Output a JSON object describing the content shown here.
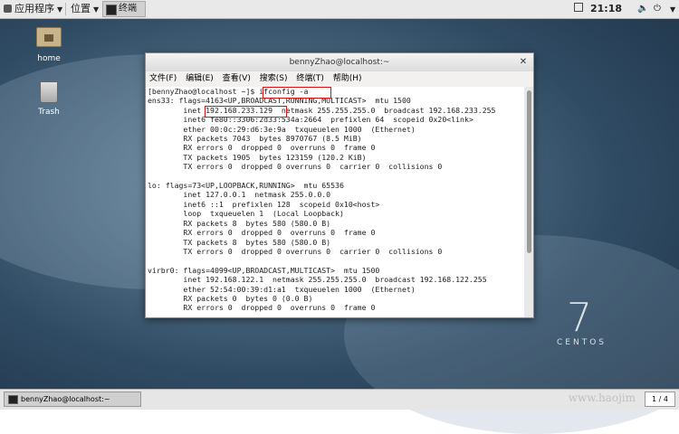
{
  "topbar": {
    "apps_label": "应用程序",
    "places_label": "位置",
    "terminal_label": "终端",
    "clock": "21:18"
  },
  "desktop_icons": {
    "home": "home",
    "trash": "Trash"
  },
  "window": {
    "title": "bennyZhao@localhost:~",
    "menu": [
      "文件(F)",
      "编辑(E)",
      "查看(V)",
      "搜索(S)",
      "终端(T)",
      "帮助(H)"
    ],
    "lines": [
      "[bennyZhao@localhost ~]$ ifconfig -a",
      "ens33: flags=4163<UP,BROADCAST,RUNNING,MULTICAST>  mtu 1500",
      "        inet 192.168.233.129  netmask 255.255.255.0  broadcast 192.168.233.255",
      "        inet6 fe80::3306:2d33:534a:2664  prefixlen 64  scopeid 0x20<link>",
      "        ether 00:0c:29:d6:3e:9a  txqueuelen 1000  (Ethernet)",
      "        RX packets 7043  bytes 8970767 (8.5 MiB)",
      "        RX errors 0  dropped 0  overruns 0  frame 0",
      "        TX packets 1905  bytes 123159 (120.2 KiB)",
      "        TX errors 0  dropped 0 overruns 0  carrier 0  collisions 0",
      "",
      "lo: flags=73<UP,LOOPBACK,RUNNING>  mtu 65536",
      "        inet 127.0.0.1  netmask 255.0.0.0",
      "        inet6 ::1  prefixlen 128  scopeid 0x10<host>",
      "        loop  txqueuelen 1  (Local Loopback)",
      "        RX packets 8  bytes 580 (580.0 B)",
      "        RX errors 0  dropped 0  overruns 0  frame 0",
      "        TX packets 8  bytes 580 (580.0 B)",
      "        TX errors 0  dropped 0 overruns 0  carrier 0  collisions 0",
      "",
      "virbr0: flags=4099<UP,BROADCAST,MULTICAST>  mtu 1500",
      "        inet 192.168.122.1  netmask 255.255.255.0  broadcast 192.168.122.255",
      "        ether 52:54:00:39:d1:a1  txqueuelen 1000  (Ethernet)",
      "        RX packets 0  bytes 0 (0.0 B)",
      "        RX errors 0  dropped 0  overruns 0  frame 0"
    ]
  },
  "branding": {
    "version": "7",
    "name": "CENTOS"
  },
  "taskbar": {
    "item": "bennyZhao@localhost:~",
    "pager": "1 / 4"
  },
  "watermark": "www.haojim"
}
